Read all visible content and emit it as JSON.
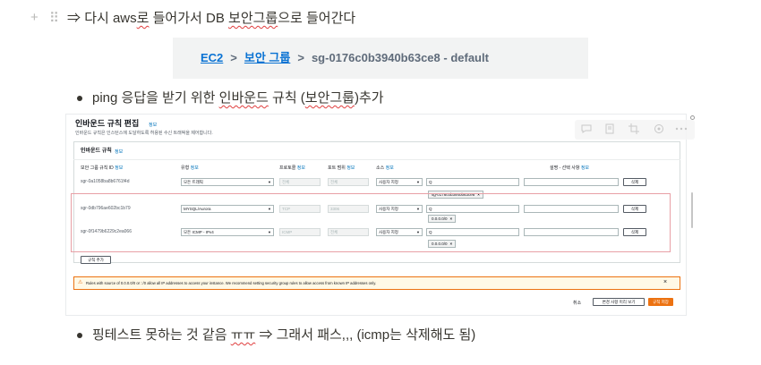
{
  "line1": {
    "arrow": "⇒",
    "text_a": "다시 aws",
    "text_b": "로",
    "text_c": "들어가서 DB",
    "text_d": "보안그룹",
    "text_e": "으로 들어간다"
  },
  "breadcrumb": {
    "ec2": "EC2",
    "sep1": ">",
    "security_group": "보안 그룹",
    "sep2": ">",
    "current": "sg-0176c0b3940b63ce8 - default"
  },
  "bullet1": {
    "text_a": "ping 응답을 받기 위한",
    "text_b": "인바운드",
    "text_c": "규칙 (",
    "text_d": "보안그룹",
    "text_e": ")추가"
  },
  "console": {
    "title": "인바운드 규칙 편집",
    "title_info": "정보",
    "subtitle": "인바운드 규칙은 인스턴스에 도달하도록 허용된 수신 트래픽을 제어합니다.",
    "panel_title": "인바운드 규칙",
    "panel_info": "정보",
    "headers": {
      "rule_id": "보안 그룹 규칙 ID",
      "type": "유형",
      "protocol": "프로토콜",
      "port": "포트 범위",
      "source": "소스",
      "desc": "설명 - 선택 사항",
      "info": "정보"
    },
    "rows": [
      {
        "id": "sgr-0a1058ba8b6761f4d",
        "type": "모든 트래픽",
        "protocol": "전체",
        "port": "전체",
        "source": "사용자 지정",
        "search": "Q",
        "chip": "sg-0176c0b3940b63ce8",
        "delete": "삭제"
      },
      {
        "id": "sgr-0db796ae602bc1b79",
        "type": "MYSQL/Aurora",
        "protocol": "TCP",
        "port": "3306",
        "source": "사용자 지정",
        "search": "Q",
        "chip": "0.0.0.0/0",
        "delete": "삭제"
      },
      {
        "id": "sgr-0f1479b6229c2ea066",
        "type": "모든 ICMP - IPv4",
        "protocol": "ICMP",
        "port": "전체",
        "source": "사용자 지정",
        "search": "Q",
        "chip": "0.0.0.0/0",
        "delete": "삭제"
      }
    ],
    "chip_close": "×",
    "caret": "▼",
    "add_rule": "규칙 추가",
    "warning_icon": "⚠",
    "warning_text": "Rules with source of 0.0.0.0/0 or ::/0 allow all IP addresses to access your instance. We recommend setting security group rules to allow access from known IP addresses only.",
    "warning_close": "×",
    "cancel": "취소",
    "preview": "변경 사항 미리 보기",
    "save": "규칙 저장"
  },
  "overlay_icons": [
    "comment-icon",
    "image-icon",
    "crop-icon",
    "settings-icon",
    "more-icon"
  ],
  "bullet2": {
    "text_a": "핑테스트 못하는 것 같음",
    "text_b": "ㅠㅠ",
    "text_c": "⇒ 그래서 패스,,, (icmp는 삭제해도 됨)"
  },
  "colors": {
    "text": "#37352f",
    "link": "#0972d3",
    "aws_orange": "#ec7211",
    "highlight_red": "#e8a0a6",
    "squiggle": "#e03e3e"
  }
}
